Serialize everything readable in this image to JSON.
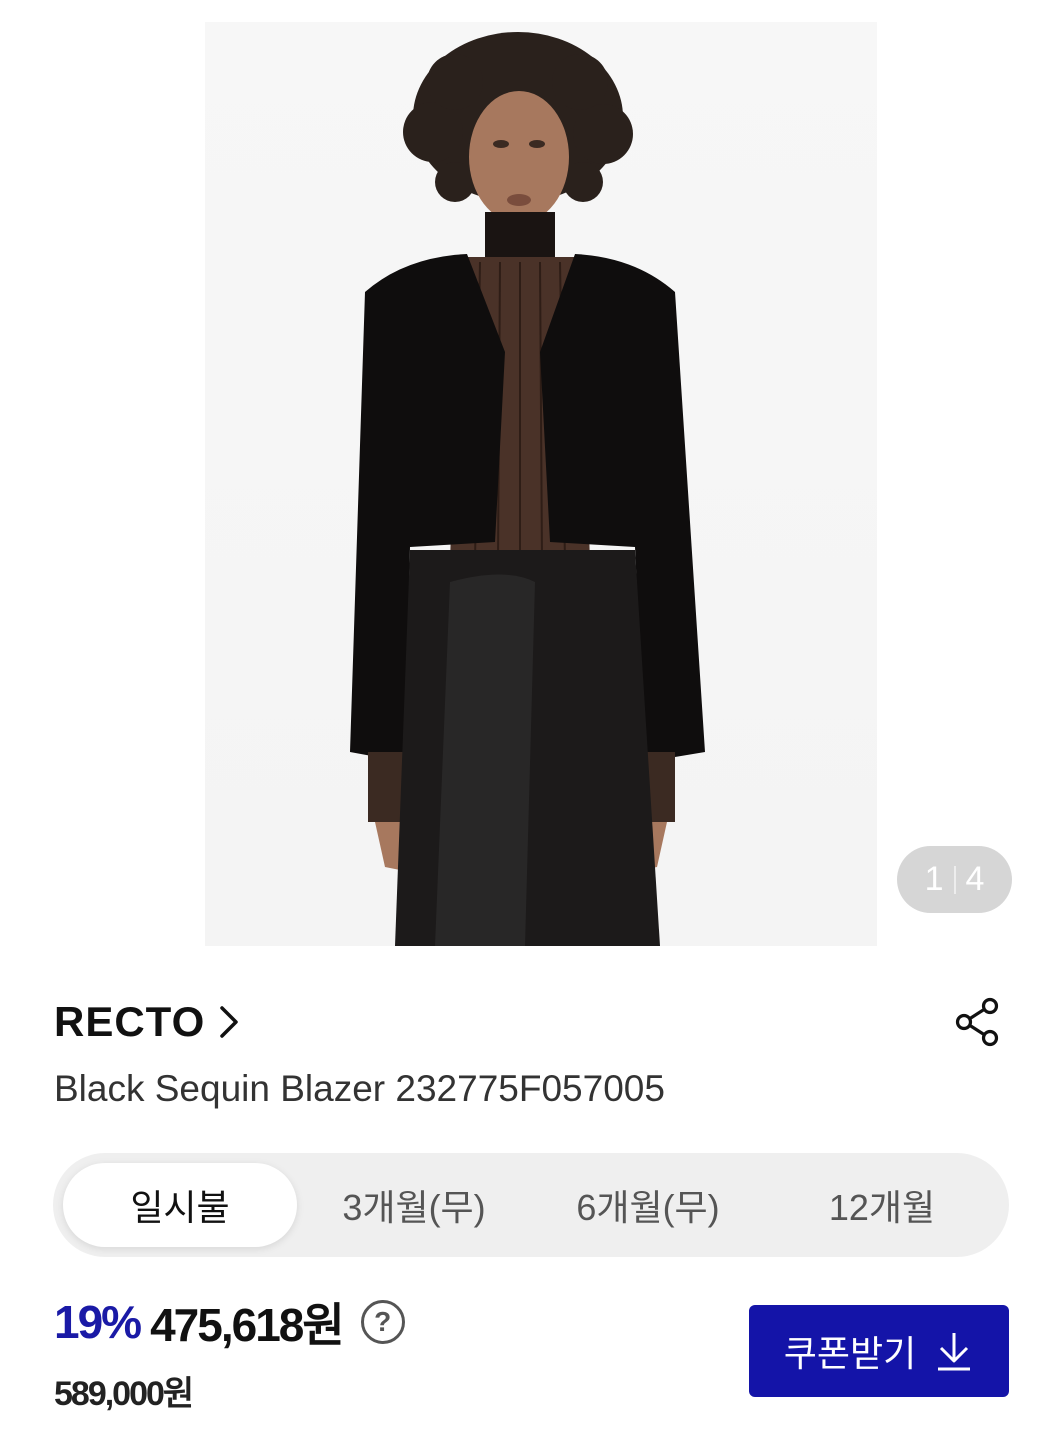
{
  "gallery": {
    "current": "1",
    "total": "4"
  },
  "brand": {
    "name": "RECTO"
  },
  "product": {
    "name": "Black Sequin Blazer 232775F057005"
  },
  "installment_tabs": [
    {
      "label": "일시불",
      "active": true
    },
    {
      "label": "3개월(무)",
      "active": false
    },
    {
      "label": "6개월(무)",
      "active": false
    },
    {
      "label": "12개월",
      "active": false
    }
  ],
  "price": {
    "discount": "19%",
    "sale": "475,618원",
    "help_symbol": "?",
    "original": "589,000원"
  },
  "coupon": {
    "label": "쿠폰받기"
  },
  "colors": {
    "accent": "#1414a8",
    "discount": "#1a1aa6",
    "tab_bg": "#efefef",
    "pager_bg": "#d6d6d6"
  },
  "icons": [
    "chevron-right-icon",
    "share-icon",
    "question-icon",
    "download-arrow-icon"
  ]
}
